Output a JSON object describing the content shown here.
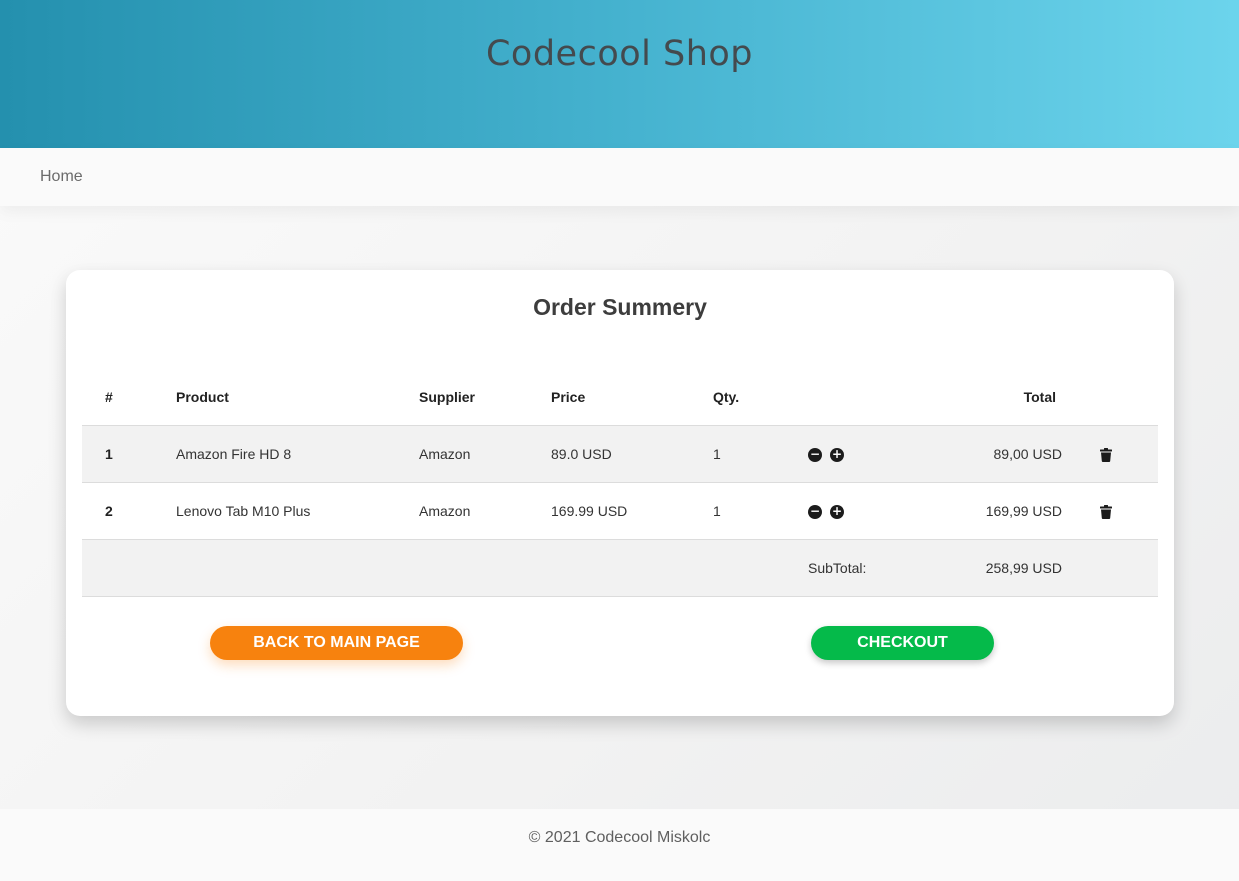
{
  "header": {
    "title": "Codecool Shop"
  },
  "nav": {
    "home_label": "Home"
  },
  "summary": {
    "heading": "Order Summery",
    "columns": [
      "#",
      "Product",
      "Supplier",
      "Price",
      "Qty.",
      "Total"
    ],
    "rows": [
      {
        "num": "1",
        "product": "Amazon Fire HD 8",
        "supplier": "Amazon",
        "price": "89.0 USD",
        "qty": "1",
        "total": "89,00 USD"
      },
      {
        "num": "2",
        "product": "Lenovo Tab M10 Plus",
        "supplier": "Amazon",
        "price": "169.99 USD",
        "qty": "1",
        "total": "169,99 USD"
      }
    ],
    "subtotal_label": "SubTotal:",
    "subtotal_value": "258,99 USD"
  },
  "buttons": {
    "back_label": "BACK TO MAIN PAGE",
    "checkout_label": "CHECKOUT"
  },
  "icons": {
    "decrease": "minus-circle-icon",
    "increase": "plus-circle-icon",
    "delete": "trash-icon"
  },
  "colors": {
    "back_button": "#f7820e",
    "checkout_button": "#05ba4a",
    "header_start": "#2490ae",
    "header_end": "#6cd4ec"
  },
  "footer": {
    "copyright": "© 2021 Codecool Miskolc"
  }
}
